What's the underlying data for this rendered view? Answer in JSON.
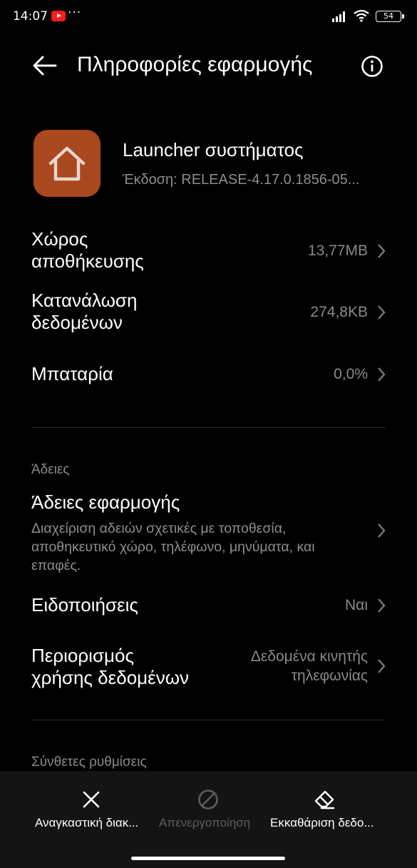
{
  "status_bar": {
    "time": "14:07",
    "more": "···",
    "battery": "54",
    "icons": [
      "youtube-icon",
      "signal-icon",
      "wifi-icon",
      "battery-icon"
    ]
  },
  "header": {
    "title": "Πληροφορίες εφαρμογής",
    "icons": [
      "back-arrow-icon",
      "info-icon"
    ]
  },
  "app": {
    "name": "Launcher συστήματος",
    "version": "Έκδοση: RELEASE-4.17.0.1856-05...",
    "icon": "home-icon",
    "icon_color": "#a9471f"
  },
  "rows": {
    "storage": {
      "label_line1": "Χώρος",
      "label_line2": "αποθήκευσης",
      "value": "13,77MB"
    },
    "data_usage": {
      "label_line1": "Κατανάλωση",
      "label_line2": "δεδομένων",
      "value": "274,8KB"
    },
    "battery": {
      "label": "Μπαταρία",
      "value": "0,0%"
    }
  },
  "permissions_section": {
    "header": "Άδειες",
    "app_permissions": {
      "title": "Άδειες εφαρμογής",
      "desc_line1": "Διαχείριση αδειών σχετικές με τοποθεσία,",
      "desc_line2": "αποθηκευτικό χώρο, τηλέφωνο, μηνύματα, και",
      "desc_line3": "επαφές."
    },
    "notifications": {
      "label": "Ειδοποιήσεις",
      "value": "Ναι"
    },
    "data_restriction": {
      "label_line1": "Περιορισμός",
      "label_line2": "χρήσης δεδομένων",
      "value_line1": "Δεδομένα κινητής",
      "value_line2": "τηλεφωνίας"
    }
  },
  "advanced_section": {
    "header": "Σύνθετες ρυθμίσεις"
  },
  "bottom_actions": {
    "force_stop": {
      "label": "Αναγκαστική διακ...",
      "icon": "close-icon",
      "enabled": true
    },
    "disable": {
      "label": "Απενεργοποίηση",
      "icon": "disable-icon",
      "enabled": false
    },
    "clear_data": {
      "label": "Εκκαθάριση δεδο...",
      "icon": "eraser-icon",
      "enabled": true
    }
  }
}
